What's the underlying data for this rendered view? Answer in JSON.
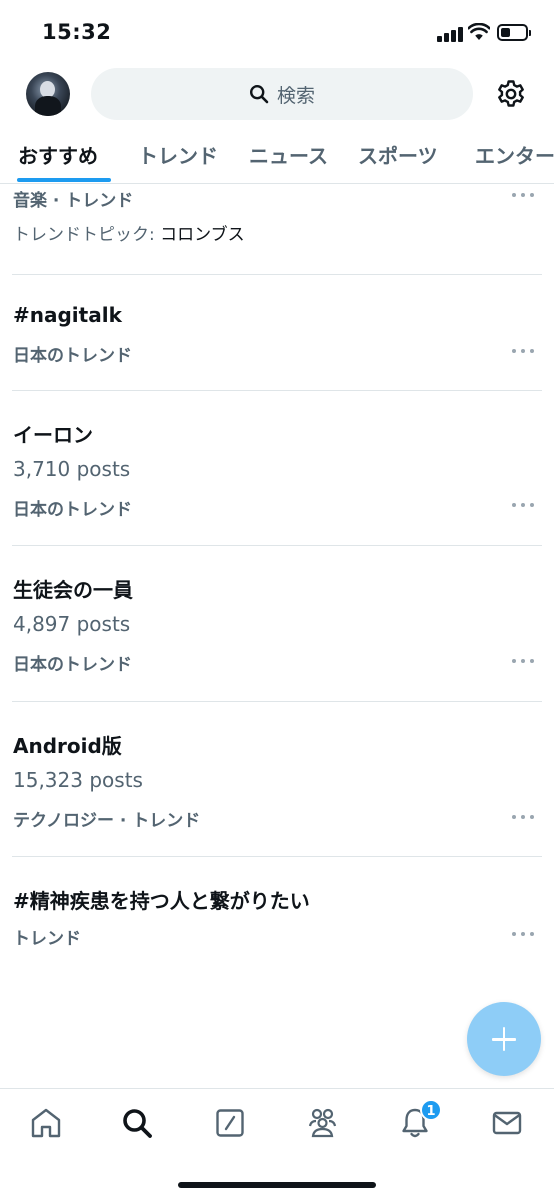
{
  "status_bar": {
    "time": "15:32"
  },
  "header": {
    "search_placeholder": "検索",
    "search_icon": "search-icon",
    "settings_icon": "gear-icon",
    "avatar": "avatar"
  },
  "tabs": [
    {
      "label": "おすすめ",
      "active": true
    },
    {
      "label": "トレンド",
      "active": false
    },
    {
      "label": "ニュース",
      "active": false
    },
    {
      "label": "スポーツ",
      "active": false
    },
    {
      "label": "エンター",
      "active": false
    }
  ],
  "trends": [
    {
      "context": "音楽 · トレンド",
      "topic_label": "トレンドトピック:",
      "topic_value": "コロンブス"
    },
    {
      "name": "#nagitalk",
      "context": "日本のトレンド"
    },
    {
      "name": "イーロン",
      "posts": "3,710 posts",
      "context": "日本のトレンド"
    },
    {
      "name": "生徒会の一員",
      "posts": "4,897 posts",
      "context": "日本のトレンド"
    },
    {
      "name": "Android版",
      "posts": "15,323 posts",
      "context": "テクノロジー · トレンド"
    },
    {
      "name": "#精神疾患を持つ人と繋がりたい",
      "context": "トレンド"
    }
  ],
  "fab": {
    "icon": "plus-icon"
  },
  "bottom_nav": {
    "items": [
      "home-icon",
      "search-icon",
      "grok-icon",
      "communities-icon",
      "notifications-icon",
      "messages-icon"
    ],
    "notification_badge": "1"
  },
  "colors": {
    "accent": "#1d9bf0",
    "fab": "#8ecdf7",
    "secondary_text": "#536471",
    "primary_text": "#0f1419"
  }
}
